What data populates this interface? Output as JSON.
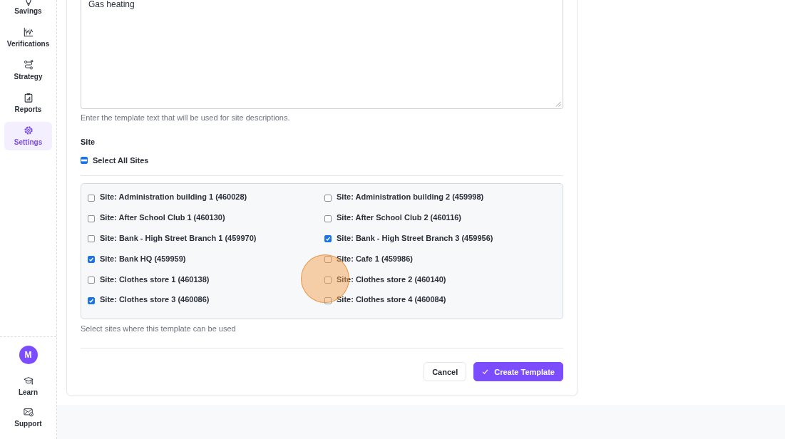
{
  "sidebar": {
    "nav": [
      {
        "label": "Savings",
        "selected": false
      },
      {
        "label": "Verifications",
        "selected": false
      },
      {
        "label": "Strategy",
        "selected": false
      },
      {
        "label": "Reports",
        "selected": false
      },
      {
        "label": "Settings",
        "selected": true
      }
    ],
    "avatar": "M",
    "links": [
      {
        "label": "Learn"
      },
      {
        "label": "Support"
      }
    ]
  },
  "form": {
    "template_text": {
      "value": "Gas heating",
      "helper": "Enter the template text that will be used for site descriptions."
    },
    "site": {
      "label": "Site",
      "select_all": {
        "label": "Select All Sites",
        "partial": true
      },
      "sites": [
        {
          "label": "Site: Administration building 1 (460028)",
          "checked": false
        },
        {
          "label": "Site: Administration building 2 (459998)",
          "checked": false
        },
        {
          "label": "Site: After School Club 1 (460130)",
          "checked": false
        },
        {
          "label": "Site: After School Club 2 (460116)",
          "checked": false
        },
        {
          "label": "Site: Bank - High Street Branch 1 (459970)",
          "checked": false
        },
        {
          "label": "Site: Bank - High Street Branch 3 (459956)",
          "checked": true
        },
        {
          "label": "Site: Bank HQ (459959)",
          "checked": true
        },
        {
          "label": "Site: Cafe 1 (459986)",
          "checked": false
        },
        {
          "label": "Site: Clothes store 1 (460138)",
          "checked": false
        },
        {
          "label": "Site: Clothes store 2 (460140)",
          "checked": false
        },
        {
          "label": "Site: Clothes store 3 (460086)",
          "checked": true
        },
        {
          "label": "Site: Clothes store 4 (460084)",
          "checked": false
        }
      ],
      "helper": "Select sites where this template can be used"
    },
    "actions": [
      {
        "label": "Cancel",
        "kind": "secondary"
      },
      {
        "label": "Create Template",
        "kind": "primary"
      }
    ]
  }
}
